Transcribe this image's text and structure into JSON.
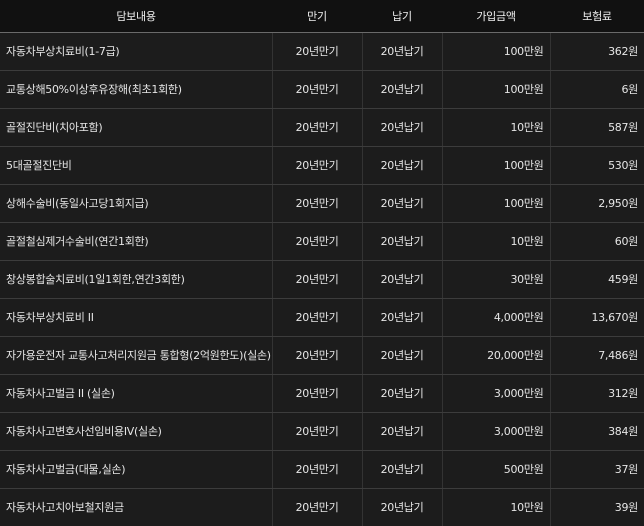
{
  "columns": {
    "coverage": "담보내용",
    "term": "만기",
    "payment": "납기",
    "amount": "가입금액",
    "premium": "보험료"
  },
  "rows": [
    {
      "coverage": "자동차부상치료비(1-7급)",
      "term": "20년만기",
      "payment": "20년납기",
      "amount": "100만원",
      "premium": "362원"
    },
    {
      "coverage": "교통상해50%이상후유장해(최초1회한)",
      "term": "20년만기",
      "payment": "20년납기",
      "amount": "100만원",
      "premium": "6원"
    },
    {
      "coverage": "골절진단비(치아포함)",
      "term": "20년만기",
      "payment": "20년납기",
      "amount": "10만원",
      "premium": "587원"
    },
    {
      "coverage": "5대골절진단비",
      "term": "20년만기",
      "payment": "20년납기",
      "amount": "100만원",
      "premium": "530원"
    },
    {
      "coverage": "상해수술비(동일사고당1회지급)",
      "term": "20년만기",
      "payment": "20년납기",
      "amount": "100만원",
      "premium": "2,950원"
    },
    {
      "coverage": "골절철심제거수술비(연간1회한)",
      "term": "20년만기",
      "payment": "20년납기",
      "amount": "10만원",
      "premium": "60원"
    },
    {
      "coverage": "창상봉합술치료비(1일1회한,연간3회한)",
      "term": "20년만기",
      "payment": "20년납기",
      "amount": "30만원",
      "premium": "459원"
    },
    {
      "coverage": "자동차부상치료비 II",
      "term": "20년만기",
      "payment": "20년납기",
      "amount": "4,000만원",
      "premium": "13,670원"
    },
    {
      "coverage": "자가용운전자 교통사고처리지원금 통합형(2억원한도)(실손)",
      "term": "20년만기",
      "payment": "20년납기",
      "amount": "20,000만원",
      "premium": "7,486원"
    },
    {
      "coverage": "자동차사고벌금 II (실손)",
      "term": "20년만기",
      "payment": "20년납기",
      "amount": "3,000만원",
      "premium": "312원"
    },
    {
      "coverage": "자동차사고변호사선임비용IV(실손)",
      "term": "20년만기",
      "payment": "20년납기",
      "amount": "3,000만원",
      "premium": "384원"
    },
    {
      "coverage": "자동차사고벌금(대물,실손)",
      "term": "20년만기",
      "payment": "20년납기",
      "amount": "500만원",
      "premium": "37원"
    },
    {
      "coverage": "자동차사고치아보철지원금",
      "term": "20년만기",
      "payment": "20년납기",
      "amount": "10만원",
      "premium": "39원"
    }
  ]
}
